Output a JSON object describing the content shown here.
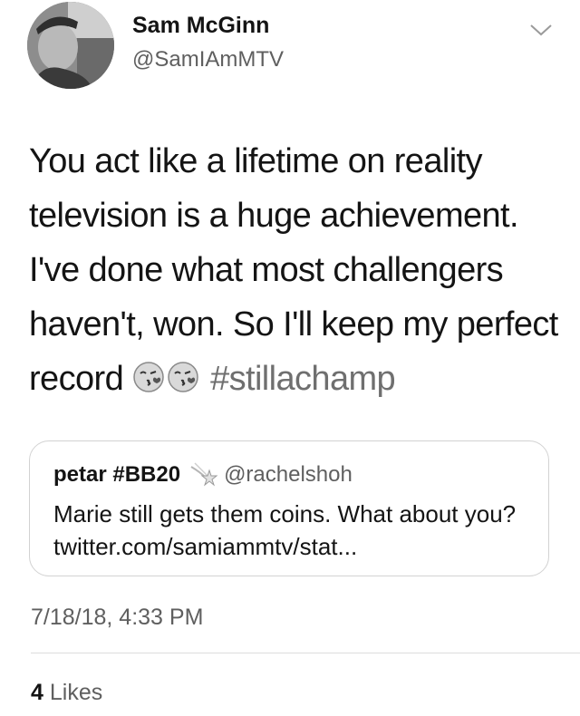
{
  "user": {
    "display_name": "Sam McGinn",
    "handle": "@SamIAmMTV"
  },
  "tweet": {
    "text_before_emoji": "You act like a lifetime on reality television is a huge achievement. I've done what most challengers haven't, won. So I'll keep my perfect record",
    "emojis": [
      "kissing-face-icon",
      "kissing-face-icon"
    ],
    "hashtag": "#stillachamp"
  },
  "quoted_tweet": {
    "name": "petar #BB20",
    "badge_icon": "shooting-star-icon",
    "handle": "@rachelshoh",
    "text": "Marie still gets them coins. What about you? twitter.com/samiammtv/stat..."
  },
  "timestamp": "7/18/18, 4:33 PM",
  "likes": {
    "count": "4",
    "label": "Likes"
  },
  "colors": {
    "text": "#141414",
    "secondary": "#5f5f5f",
    "border": "#d2d2d2"
  }
}
